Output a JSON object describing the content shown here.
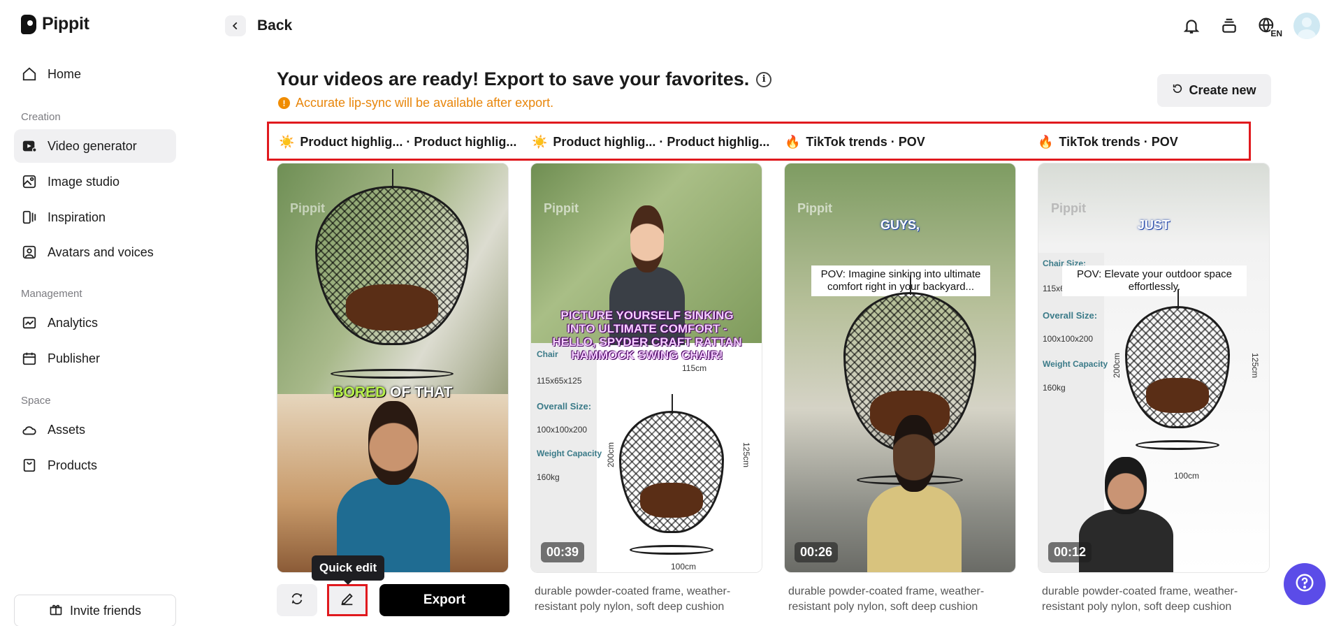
{
  "app": {
    "logo_text": "Pippit"
  },
  "sidebar": {
    "items": [
      {
        "label": "Home",
        "icon": "home-icon"
      },
      {
        "label": "Video generator",
        "icon": "video-generator-icon"
      },
      {
        "label": "Image studio",
        "icon": "image-studio-icon"
      },
      {
        "label": "Inspiration",
        "icon": "inspiration-icon"
      },
      {
        "label": "Avatars and voices",
        "icon": "avatar-icon"
      },
      {
        "label": "Analytics",
        "icon": "analytics-icon"
      },
      {
        "label": "Publisher",
        "icon": "calendar-icon"
      },
      {
        "label": "Assets",
        "icon": "cloud-icon"
      },
      {
        "label": "Products",
        "icon": "products-icon"
      }
    ],
    "sections": {
      "creation": "Creation",
      "management": "Management",
      "space": "Space"
    },
    "active": "Video generator",
    "invite_label": "Invite friends"
  },
  "header": {
    "back_label": "Back",
    "language_badge": "EN"
  },
  "main": {
    "title": "Your videos are ready! Export to save your favorites.",
    "warning": "Accurate lip-sync will be available after export.",
    "create_new_label": "Create new",
    "tabs": [
      {
        "emoji": "☀️",
        "label": "Product highlig... · Product highlig..."
      },
      {
        "emoji": "☀️",
        "label": "Product highlig... · Product highlig..."
      },
      {
        "emoji": "🔥",
        "label": "TikTok trends · POV"
      },
      {
        "emoji": "🔥",
        "label": "TikTok trends · POV"
      }
    ],
    "cards": [
      {
        "watermark": "Pippit",
        "overlay_text_a": "BORED",
        "overlay_text_b": " OF THAT",
        "duration": "",
        "description": ""
      },
      {
        "watermark": "Pippit",
        "overlay_text": "PICTURE YOURSELF SINKING INTO ULTIMATE COMFORT - HELLO, SPYDER CRAFT RATTAN HAMMOCK SWING CHAIR!",
        "duration": "00:39",
        "description": "durable powder-coated frame, weather-resistant poly nylon, soft deep cushion",
        "specs": {
          "chair_label": "Chair",
          "chair_dim": "115x65x125",
          "overall_label": "Overall Size:",
          "overall_dim": "100x100x200",
          "weight_label": "Weight Capacity",
          "weight": "160kg",
          "w_dim": "115cm",
          "h_dim": "200cm",
          "h2_dim": "125cm",
          "b_dim": "100cm"
        }
      },
      {
        "watermark": "Pippit",
        "overlay_word": "GUYS,",
        "caption": "POV: Imagine sinking into ultimate comfort right in your backyard...",
        "duration": "00:26",
        "description": "durable powder-coated frame, weather-resistant poly nylon, soft deep cushion"
      },
      {
        "watermark": "Pippit",
        "overlay_word": "JUST",
        "caption": "POV: Elevate your outdoor space effortlessly.",
        "duration": "00:12",
        "description": "durable powder-coated frame, weather-resistant poly nylon, soft deep cushion",
        "specs": {
          "chair_label": "Chair Size:",
          "chair_dim": "115x65x125",
          "overall_label": "Overall Size:",
          "overall_dim": "100x100x200",
          "weight_label": "Weight Capacity",
          "weight": "160kg",
          "h_dim": "200cm",
          "h2_dim": "125cm",
          "b_dim": "100cm"
        }
      }
    ],
    "actions": {
      "tooltip": "Quick edit",
      "export_label": "Export"
    }
  },
  "colors": {
    "accent": "#5b4ce8",
    "highlight_border": "#e0191e",
    "warning": "#e8860b"
  }
}
